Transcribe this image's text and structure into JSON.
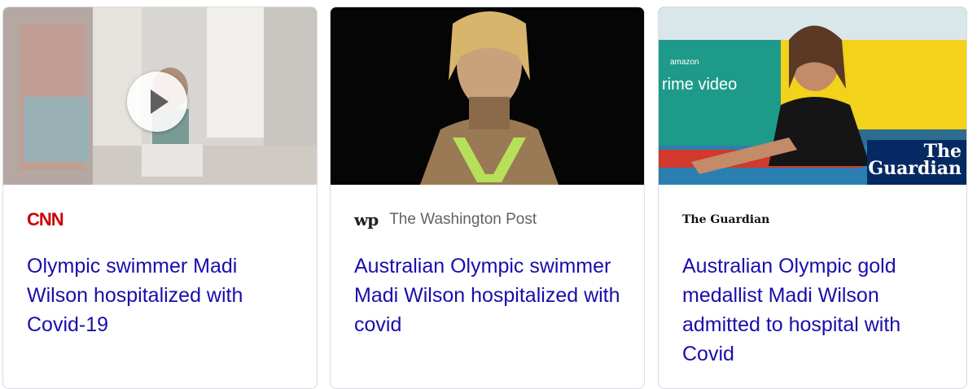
{
  "cards": [
    {
      "source": "CNN",
      "headline": "Olympic swimmer Madi Wilson hospitalized with Covid-19",
      "thumb": {
        "type": "video",
        "play_icon": "play-icon"
      }
    },
    {
      "source": "The Washington Post",
      "source_logo": "wp",
      "headline": "Australian Olympic swimmer Madi Wilson hospitalized with covid",
      "thumb": {
        "type": "photo"
      }
    },
    {
      "source": "The Guardian",
      "headline": "Australian Olympic gold medallist Madi Wilson admitted to hospital with Covid",
      "thumb": {
        "type": "photo",
        "overlay_text_amazon": "amazon",
        "overlay_text_prime": "rime video",
        "badge_line1": "The",
        "badge_line2": "Guardian"
      }
    }
  ],
  "colors": {
    "headline": "#1a0dab",
    "cnn_red": "#cc0000",
    "guardian_blue": "#052962"
  }
}
